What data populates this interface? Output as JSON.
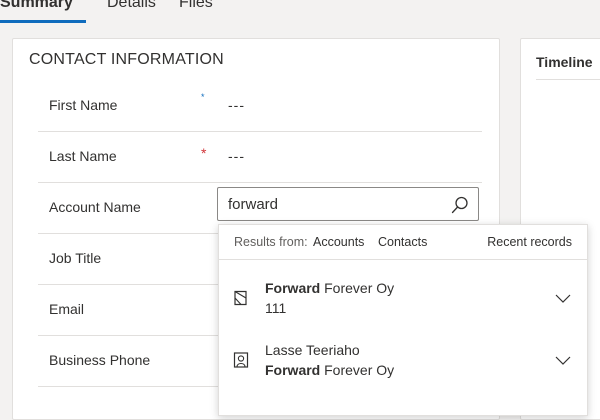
{
  "tabs": [
    {
      "label": "Summary",
      "active": true
    },
    {
      "label": "Details",
      "active": false
    },
    {
      "label": "Files",
      "active": false
    }
  ],
  "contact": {
    "section_title": "CONTACT INFORMATION",
    "fields": [
      {
        "label": "First Name",
        "required_marker": "*",
        "value": "---"
      },
      {
        "label": "Last Name",
        "required_marker": "*",
        "value": "---"
      },
      {
        "label": "Account Name"
      },
      {
        "label": "Job Title"
      },
      {
        "label": "Email"
      },
      {
        "label": "Business Phone"
      }
    ],
    "lookup": {
      "value": "forward",
      "icon": "search-icon"
    }
  },
  "timeline": {
    "title": "Timeline"
  },
  "lookup_dropdown": {
    "results_from": "Results from:",
    "filters": [
      "Accounts",
      "Contacts"
    ],
    "recent_records": "Recent records",
    "results": [
      {
        "icon": "account-icon",
        "line1_bold": "Forward",
        "line1_rest": " Forever Oy",
        "line2": "111"
      },
      {
        "icon": "contact-icon",
        "line1": "Lasse Teeriaho",
        "line2_bold": "Forward",
        "line2_rest": " Forever Oy"
      }
    ]
  },
  "colors": {
    "accent": "#0f6cbd",
    "required": "#d13438",
    "border": "#e1dfdd",
    "page_bg": "#f3f2f1"
  }
}
